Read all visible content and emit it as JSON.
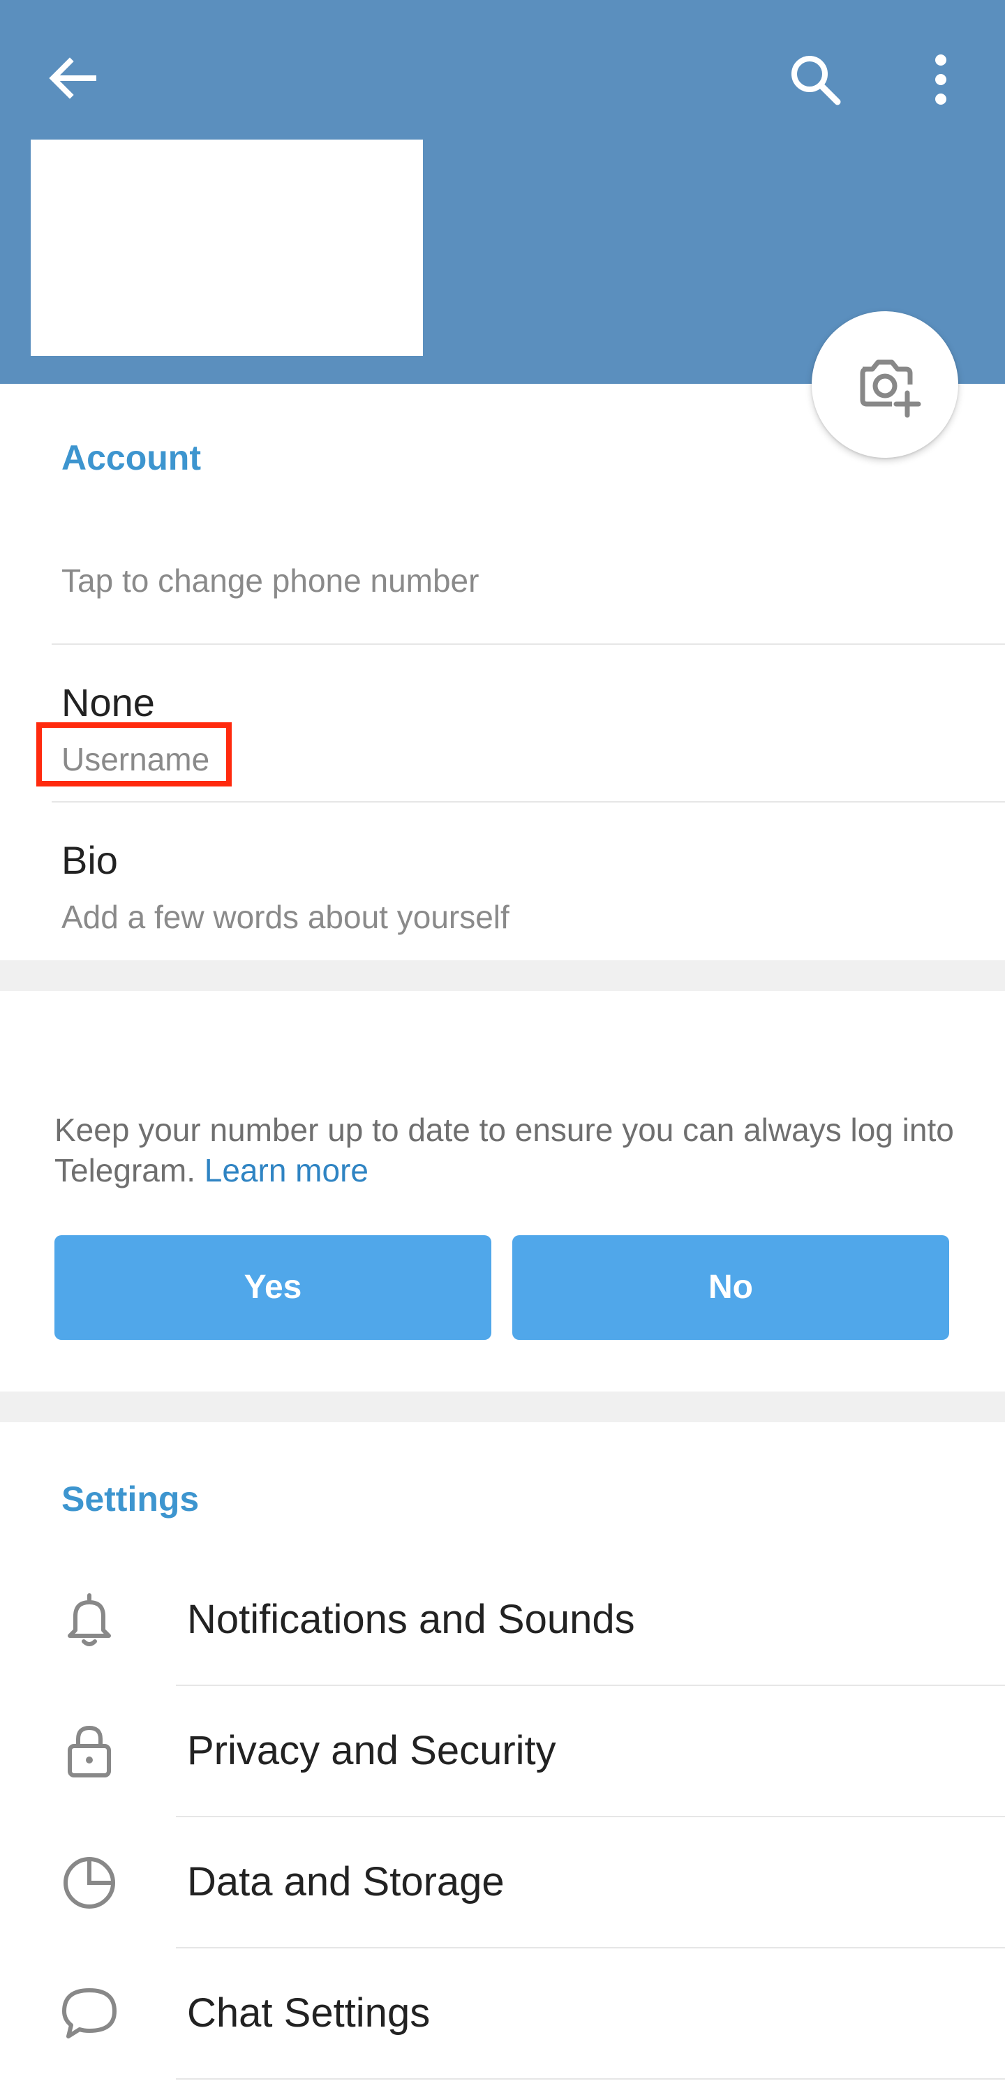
{
  "header": {
    "back_icon": "arrow-left-icon",
    "search_icon": "search-icon",
    "more_icon": "more-vertical-icon",
    "camera_icon": "camera-add-icon",
    "background_color": "#5b8fbe"
  },
  "account": {
    "title": "Account",
    "phone_hint": "Tap to change phone number",
    "username_value": "None",
    "username_label": "Username",
    "bio_title": "Bio",
    "bio_hint": "Add a few words about yourself"
  },
  "suggestion": {
    "message": "Keep your number up to date to ensure you can always log into Telegram.",
    "learn_more": "Learn more",
    "yes_label": "Yes",
    "no_label": "No",
    "button_color": "#50a7ea"
  },
  "settings": {
    "title": "Settings",
    "items": [
      {
        "label": "Notifications and Sounds",
        "icon": "bell-icon"
      },
      {
        "label": "Privacy and Security",
        "icon": "lock-icon"
      },
      {
        "label": "Data and Storage",
        "icon": "pie-chart-icon"
      },
      {
        "label": "Chat Settings",
        "icon": "chat-bubble-icon"
      }
    ]
  },
  "colors": {
    "accent": "#3d95cf",
    "highlight_box": "#ff2a0e"
  }
}
